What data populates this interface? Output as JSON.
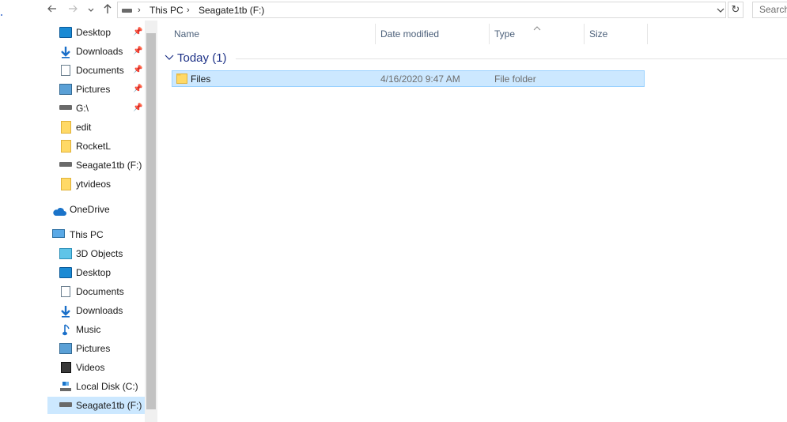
{
  "addressbar": {
    "crumbs": [
      "This PC",
      "Seagate1tb (F:)"
    ],
    "search_placeholder": "Search"
  },
  "sidebar": {
    "quick_access": [
      {
        "label": "Desktop",
        "icon": "desktop-icon",
        "pinned": true
      },
      {
        "label": "Downloads",
        "icon": "download-arrow-icon",
        "pinned": true
      },
      {
        "label": "Documents",
        "icon": "document-icon",
        "pinned": true
      },
      {
        "label": "Pictures",
        "icon": "pictures-icon",
        "pinned": true
      },
      {
        "label": "G:\\",
        "icon": "drive-icon",
        "pinned": true
      },
      {
        "label": "edit",
        "icon": "folder-icon",
        "pinned": false
      },
      {
        "label": "RocketL",
        "icon": "folder-icon",
        "pinned": false
      },
      {
        "label": "Seagate1tb (F:)",
        "icon": "drive-icon",
        "pinned": false
      },
      {
        "label": "ytvideos",
        "icon": "folder-icon",
        "pinned": false
      }
    ],
    "onedrive": {
      "label": "OneDrive",
      "icon": "cloud-icon"
    },
    "this_pc": {
      "label": "This PC",
      "icon": "computer-icon"
    },
    "this_pc_items": [
      {
        "label": "3D Objects",
        "icon": "cube-icon"
      },
      {
        "label": "Desktop",
        "icon": "desktop-icon"
      },
      {
        "label": "Documents",
        "icon": "document-icon"
      },
      {
        "label": "Downloads",
        "icon": "download-arrow-icon"
      },
      {
        "label": "Music",
        "icon": "music-note-icon"
      },
      {
        "label": "Pictures",
        "icon": "pictures-icon"
      },
      {
        "label": "Videos",
        "icon": "film-icon"
      },
      {
        "label": "Local Disk (C:)",
        "icon": "drive-icon"
      },
      {
        "label": "Seagate1tb (F:)",
        "icon": "drive-icon",
        "selected": true
      }
    ]
  },
  "columns": {
    "name": "Name",
    "date": "Date modified",
    "type": "Type",
    "size": "Size"
  },
  "group": {
    "label": "Today (1)"
  },
  "files": [
    {
      "name": "Files",
      "date": "4/16/2020 9:47 AM",
      "type": "File folder",
      "size": ""
    }
  ],
  "colors": {
    "selection": "#cce8ff",
    "selection_border": "#99d1ff",
    "group_header": "#1e3287",
    "header_text": "#4c607a"
  }
}
